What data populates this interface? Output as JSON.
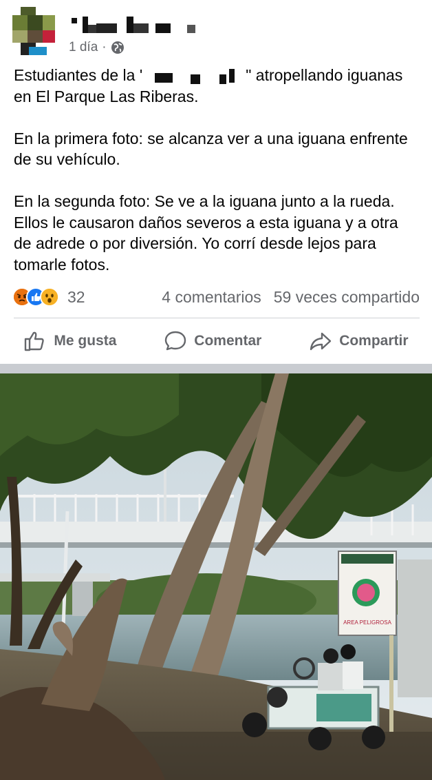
{
  "post": {
    "author_name": "",
    "time": "1 día",
    "visibility_icon": "globe-icon",
    "text": {
      "p1_before": "Estudiantes de la '",
      "p1_after": "\" atropellando iguanas en El Parque Las Riberas.",
      "p2": "En la primera foto: se alcanza ver a una iguana enfrente de su vehículo.",
      "p3": "En la segunda foto: Se ve a la iguana junto a la rueda. Ellos le causaron daños severos a esta iguana y a otra de adrede o por diversión. Yo corrí desde lejos para tomarle fotos."
    }
  },
  "reactions": {
    "icons": [
      "angry-icon",
      "like-icon",
      "wow-icon"
    ],
    "count": "32",
    "comments": "4 comentarios",
    "shares": "59 veces compartido"
  },
  "actions": {
    "like": "Me gusta",
    "comment": "Comentar",
    "share": "Compartir"
  },
  "photo": {
    "sign_text": "AREA PELIGROSA"
  },
  "colors": {
    "secondary_text": "#65676b",
    "like_blue": "#1877f2",
    "angry_orange": "#e9710f",
    "wow_yellow": "#f7b125"
  }
}
